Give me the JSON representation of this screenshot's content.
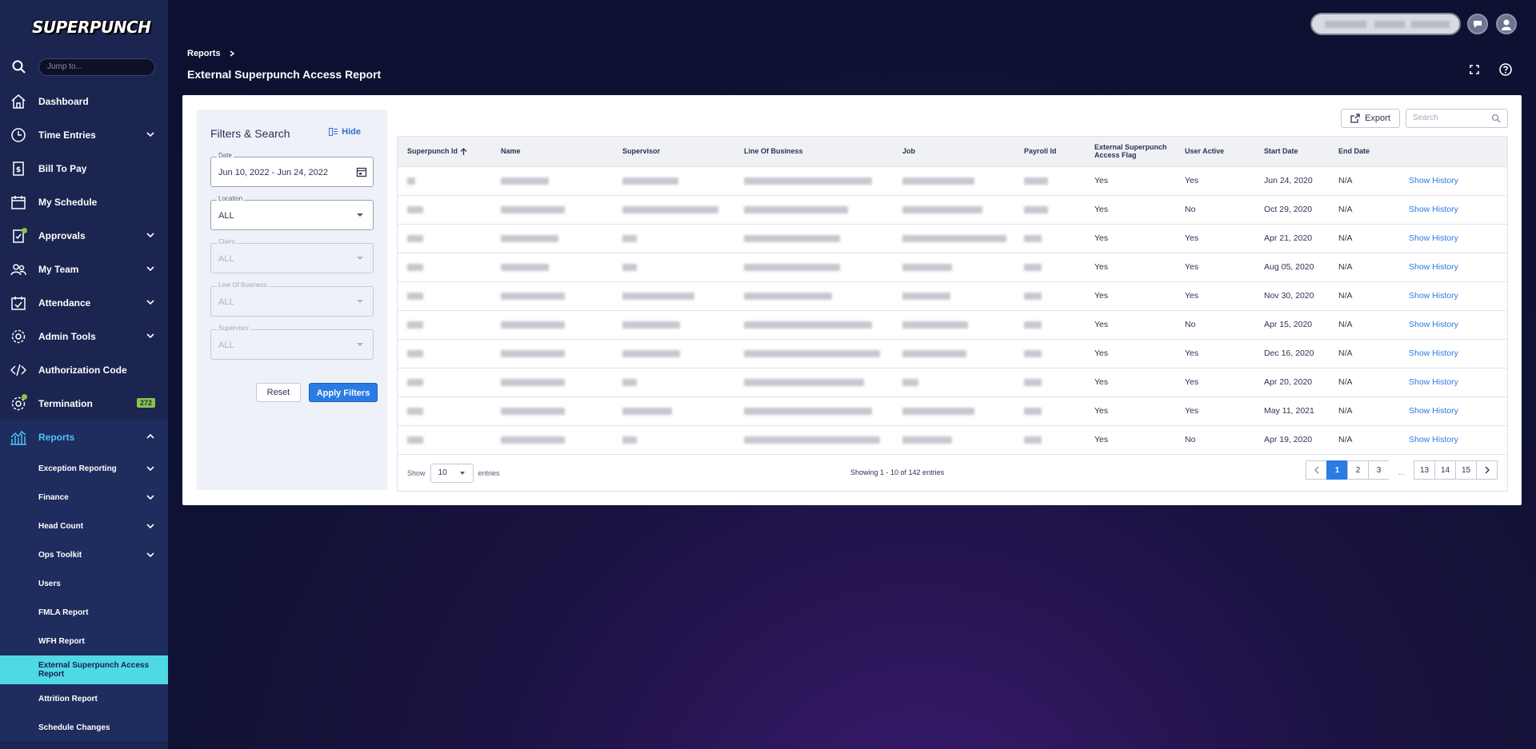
{
  "app": {
    "logo": "SUPERPUNCH",
    "jump_placeholder": "Jump to..."
  },
  "sidebar": {
    "items": [
      {
        "label": "Dashboard"
      },
      {
        "label": "Time Entries"
      },
      {
        "label": "Bill To Pay"
      },
      {
        "label": "My Schedule"
      },
      {
        "label": "Approvals"
      },
      {
        "label": "My Team"
      },
      {
        "label": "Attendance"
      },
      {
        "label": "Admin Tools"
      },
      {
        "label": "Authorization Code"
      },
      {
        "label": "Termination",
        "badge": "272"
      },
      {
        "label": "Reports"
      }
    ],
    "reports_sub": [
      {
        "label": "Exception Reporting"
      },
      {
        "label": "Finance"
      },
      {
        "label": "Head Count"
      },
      {
        "label": "Ops Toolkit"
      },
      {
        "label": "Users"
      },
      {
        "label": "FMLA Report"
      },
      {
        "label": "WFH Report"
      },
      {
        "label": "External Superpunch Access Report"
      },
      {
        "label": "Attrition Report"
      },
      {
        "label": "Schedule Changes"
      }
    ]
  },
  "header": {
    "breadcrumb": "Reports",
    "title": "External Superpunch Access Report"
  },
  "filters": {
    "title": "Filters & Search",
    "hide": "Hide",
    "date_label": "Date",
    "date_value": "Jun 10, 2022 - Jun 24, 2022",
    "location_label": "Location",
    "location_value": "ALL",
    "client_label": "Client",
    "client_value": "ALL",
    "lob_label": "Line Of Business",
    "lob_value": "ALL",
    "supervisor_label": "Supervisor",
    "supervisor_value": "ALL",
    "reset": "Reset",
    "apply": "Apply Filters"
  },
  "toolbar": {
    "export": "Export",
    "search_placeholder": "Search"
  },
  "table": {
    "columns": [
      "Superpunch Id",
      "Name",
      "Supervisor",
      "Line Of Business",
      "Job",
      "Payroll Id",
      "External Superpunch Access Flag",
      "User Active",
      "Start Date",
      "End Date",
      ""
    ],
    "rows": [
      {
        "flag": "Yes",
        "active": "Yes",
        "start": "Jun 24, 2020",
        "end": "N/A",
        "action": "Show History"
      },
      {
        "flag": "Yes",
        "active": "No",
        "start": "Oct 29, 2020",
        "end": "N/A",
        "action": "Show History"
      },
      {
        "flag": "Yes",
        "active": "Yes",
        "start": "Apr 21, 2020",
        "end": "N/A",
        "action": "Show History"
      },
      {
        "flag": "Yes",
        "active": "Yes",
        "start": "Aug 05, 2020",
        "end": "N/A",
        "action": "Show History"
      },
      {
        "flag": "Yes",
        "active": "Yes",
        "start": "Nov 30, 2020",
        "end": "N/A",
        "action": "Show History"
      },
      {
        "flag": "Yes",
        "active": "No",
        "start": "Apr 15, 2020",
        "end": "N/A",
        "action": "Show History"
      },
      {
        "flag": "Yes",
        "active": "Yes",
        "start": "Dec 16, 2020",
        "end": "N/A",
        "action": "Show History"
      },
      {
        "flag": "Yes",
        "active": "Yes",
        "start": "Apr 20, 2020",
        "end": "N/A",
        "action": "Show History"
      },
      {
        "flag": "Yes",
        "active": "Yes",
        "start": "May 11, 2021",
        "end": "N/A",
        "action": "Show History"
      },
      {
        "flag": "Yes",
        "active": "No",
        "start": "Apr 19, 2020",
        "end": "N/A",
        "action": "Show History"
      }
    ]
  },
  "footer": {
    "show": "Show",
    "page_size": "10",
    "entries": "entries",
    "showing": "Showing 1 - 10 of 142 entries",
    "pages": [
      "1",
      "2",
      "3",
      "...",
      "13",
      "14",
      "15"
    ]
  }
}
